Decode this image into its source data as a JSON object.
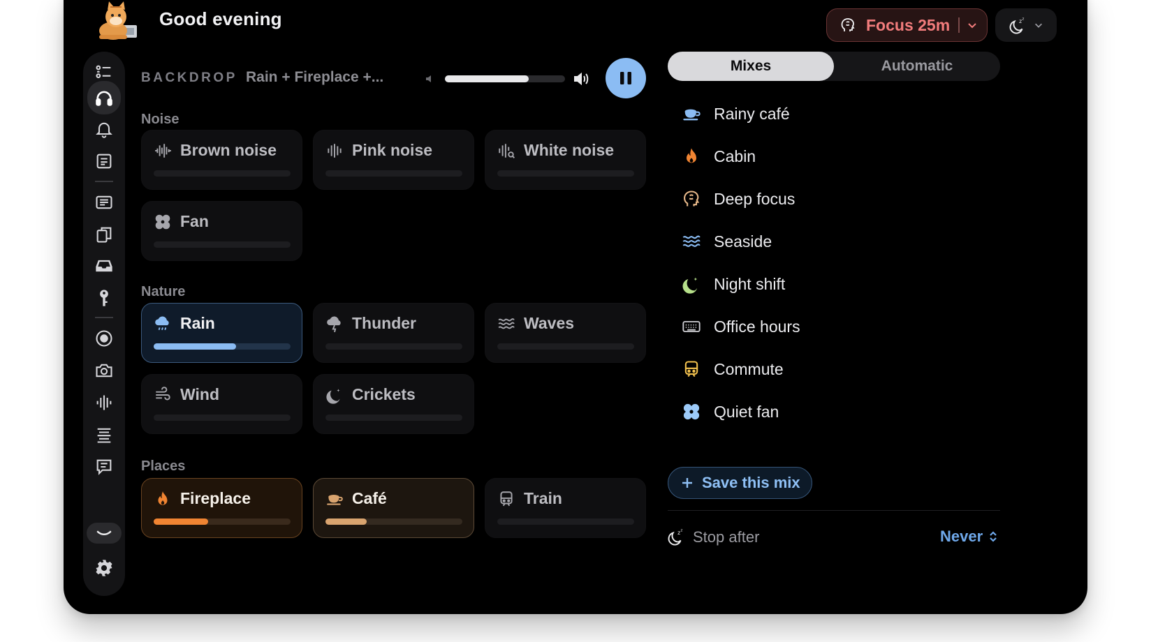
{
  "header": {
    "greeting": "Good evening",
    "avatar_icon": "cat-avatar-icon",
    "focus_label": "Focus 25m",
    "focus_color": "#f27c7c"
  },
  "sidebar": {
    "items": [
      {
        "icon": "checklist-icon"
      },
      {
        "icon": "headphones-icon",
        "active": true
      },
      {
        "icon": "bell-icon"
      },
      {
        "icon": "note-icon"
      },
      {
        "icon": "document-icon"
      },
      {
        "icon": "copy-icon"
      },
      {
        "icon": "inbox-icon"
      },
      {
        "icon": "key-icon"
      },
      {
        "icon": "record-icon"
      },
      {
        "icon": "camera-icon"
      },
      {
        "icon": "waveform-icon"
      },
      {
        "icon": "text-lines-icon"
      },
      {
        "icon": "chat-icon"
      },
      {
        "icon": "collapse-icon"
      },
      {
        "icon": "gear-icon"
      }
    ]
  },
  "backdrop": {
    "label": "BACKDROP",
    "current": "Rain + Fireplace +...",
    "volume": 0.7,
    "playing": true
  },
  "sections": {
    "noise": {
      "title": "Noise",
      "items": [
        {
          "name": "Brown noise",
          "level": 0
        },
        {
          "name": "Pink noise",
          "level": 0
        },
        {
          "name": "White noise",
          "level": 0
        },
        {
          "name": "Fan",
          "level": 0
        }
      ]
    },
    "nature": {
      "title": "Nature",
      "items": [
        {
          "name": "Rain",
          "level": 0.6,
          "accent": "#8bbcf3"
        },
        {
          "name": "Thunder",
          "level": 0
        },
        {
          "name": "Waves",
          "level": 0
        },
        {
          "name": "Wind",
          "level": 0
        },
        {
          "name": "Crickets",
          "level": 0
        }
      ]
    },
    "places": {
      "title": "Places",
      "items": [
        {
          "name": "Fireplace",
          "level": 0.4,
          "accent": "#f08432"
        },
        {
          "name": "Café",
          "level": 0.3,
          "accent": "#d9a46f"
        },
        {
          "name": "Train",
          "level": 0
        }
      ]
    }
  },
  "right": {
    "tabs": [
      "Mixes",
      "Automatic"
    ],
    "selected_tab": "Mixes",
    "mixes": [
      {
        "name": "Rainy café",
        "icon": "coffee-cup-icon"
      },
      {
        "name": "Cabin",
        "icon": "flame-icon"
      },
      {
        "name": "Deep focus",
        "icon": "brain-head-icon"
      },
      {
        "name": "Seaside",
        "icon": "waves-icon"
      },
      {
        "name": "Night shift",
        "icon": "moon-icon"
      },
      {
        "name": "Office hours",
        "icon": "keyboard-icon"
      },
      {
        "name": "Commute",
        "icon": "train-icon"
      },
      {
        "name": "Quiet fan",
        "icon": "fan-icon"
      }
    ],
    "save_label": "Save this mix",
    "stop_after_label": "Stop after",
    "stop_after_value": "Never"
  }
}
